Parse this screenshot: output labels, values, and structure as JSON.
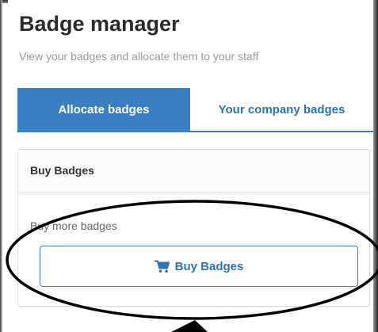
{
  "header": {
    "title": "Badge manager",
    "subtitle": "View your badges and allocate them to your staff"
  },
  "tabs": [
    {
      "label": "Allocate badges",
      "active": true
    },
    {
      "label": "Your company badges",
      "active": false
    }
  ],
  "panel": {
    "title": "Buy Badges",
    "text": "Buy more badges",
    "button_label": "Buy Badges",
    "button_icon": "shopping-cart-icon"
  },
  "colors": {
    "primary": "#3a7fc1",
    "link": "#2c73b6",
    "title_text": "#2b2b2b",
    "muted_text": "#9b9b9b"
  },
  "annotation": {
    "shape": "ellipse",
    "arrow": "pointing up"
  }
}
